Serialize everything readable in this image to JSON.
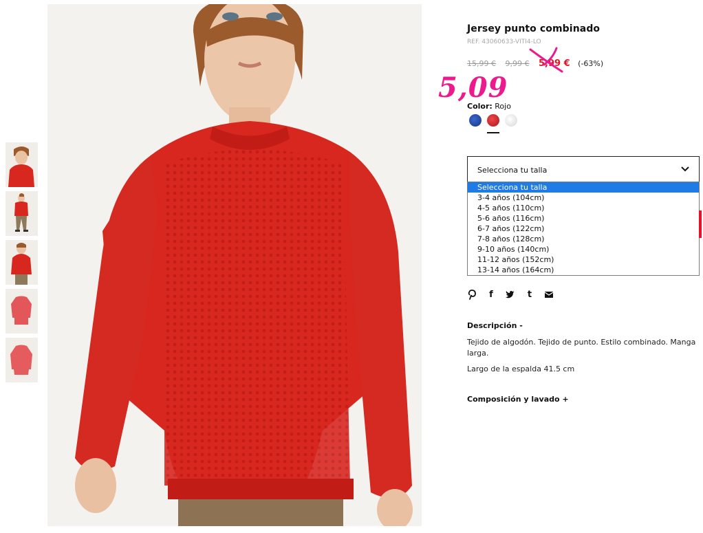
{
  "product": {
    "title": "Jersey punto combinado",
    "ref": "REF. 43060633-VITI4-LO",
    "price_original": "15,99 €",
    "price_previous": "9,99 €",
    "price_current": "5,99 €",
    "discount": "(-63%)",
    "annotation_price": "5,09",
    "annotation_color": "#ec1a8c",
    "sale_color": "#e5122a"
  },
  "color": {
    "label": "Color:",
    "value": "Rojo",
    "swatches": [
      {
        "name": "Azul",
        "hex": "#1b45a8"
      },
      {
        "name": "Rojo",
        "hex": "#d8202a"
      },
      {
        "name": "Blanco",
        "hex": "#e9e9e9"
      }
    ]
  },
  "size_select": {
    "value": "Selecciona tu talla",
    "options": [
      "Selecciona tu talla",
      "3-4 años (104cm)",
      "4-5 años (110cm)",
      "5-6 años (116cm)",
      "6-7 años (122cm)",
      "7-8 años (128cm)",
      "9-10 años (140cm)",
      "11-12 años (152cm)",
      "13-14 años (164cm)"
    ],
    "highlighted_color": "#1f7be6"
  },
  "share": {
    "icons": [
      "pinterest-icon",
      "facebook-icon",
      "twitter-icon",
      "tumblr-icon",
      "email-icon"
    ],
    "facebook_glyph": "f",
    "tumblr_glyph": "t"
  },
  "description": {
    "heading": "Descripción  -",
    "text": "Tejido de algodón. Tejido de punto. Estilo combinado. Manga larga.",
    "back_length": "Largo de la espalda 41.5 cm"
  },
  "composition": {
    "heading": "Composición y lavado  +"
  },
  "gallery": {
    "thumbnail_count": 5,
    "garment_color": "#d8271f"
  }
}
